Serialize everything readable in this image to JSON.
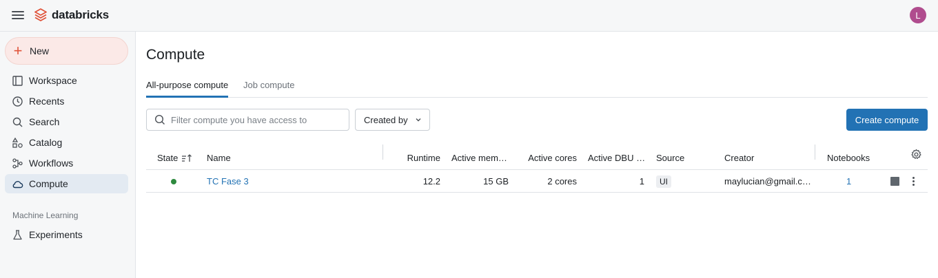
{
  "app": {
    "brand": "databricks",
    "brand_color": "#e0533a",
    "user_initial": "L",
    "avatar_color": "#b04c8e"
  },
  "sidebar": {
    "new_label": "New",
    "items": [
      {
        "label": "Workspace",
        "icon": "workspace-icon"
      },
      {
        "label": "Recents",
        "icon": "clock-icon"
      },
      {
        "label": "Search",
        "icon": "search-icon"
      },
      {
        "label": "Catalog",
        "icon": "catalog-icon"
      },
      {
        "label": "Workflows",
        "icon": "workflows-icon"
      },
      {
        "label": "Compute",
        "icon": "cloud-icon",
        "active": true
      }
    ],
    "section_ml": "Machine Learning",
    "ml_items": [
      {
        "label": "Experiments",
        "icon": "flask-icon"
      }
    ]
  },
  "main": {
    "title": "Compute",
    "tabs": [
      {
        "label": "All-purpose compute",
        "active": true
      },
      {
        "label": "Job compute",
        "active": false
      }
    ],
    "search_placeholder": "Filter compute you have access to",
    "created_by_label": "Created by",
    "create_button_label": "Create compute",
    "accent_color": "#2272b4"
  },
  "table": {
    "columns": [
      "State",
      "Name",
      "Runtime",
      "Active mem…",
      "Active cores",
      "Active DBU …",
      "Source",
      "Creator",
      "Notebooks"
    ],
    "rows": [
      {
        "state": "running",
        "name": "TC Fase 3",
        "runtime": "12.2",
        "active_memory": "15 GB",
        "active_cores": "2 cores",
        "active_dbu": "1",
        "source": "UI",
        "creator": "maylucian@gmail.c…",
        "notebooks": "1"
      }
    ]
  }
}
